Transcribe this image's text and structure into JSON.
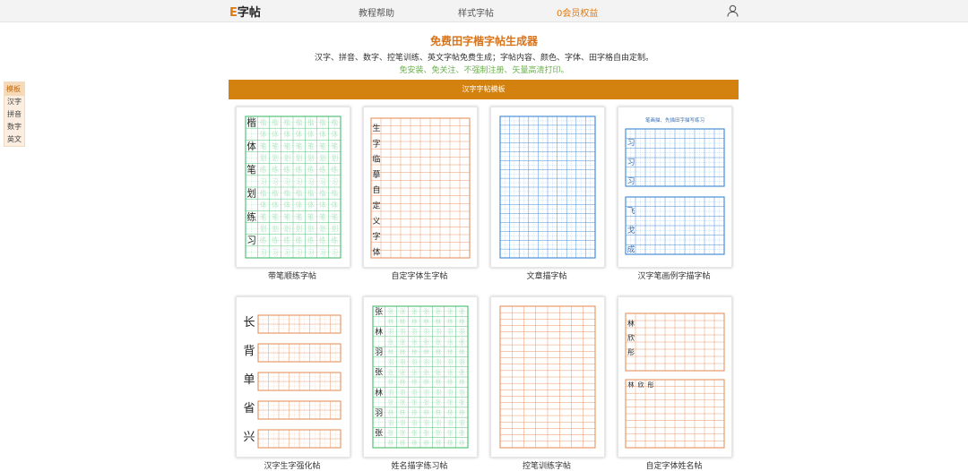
{
  "nav": {
    "logo_e": "E",
    "logo_rest": "字帖",
    "items": [
      "教程帮助",
      "样式字帖",
      "会员权益"
    ],
    "vip_mark": "0"
  },
  "hero": {
    "title": "免费田字楷字帖生成器",
    "subtitle": "汉字、拼音、数字、控笔训练、英文字帖免费生成；字帖内容、颜色、字体、田字格自由定制。",
    "subtitle2": "免安装、免关注、不强制注册、矢量高清打印。"
  },
  "sidemenu": {
    "header": "模板",
    "items": [
      "汉字",
      "拼音",
      "数字",
      "英文"
    ]
  },
  "banner": "汉字字帖模板",
  "templates": [
    {
      "caption": "带笔顺练字帖",
      "color": "#55c27a",
      "chars": [
        "楷",
        "体",
        "笔",
        "划",
        "练",
        "习"
      ]
    },
    {
      "caption": "自定字体生字帖",
      "color": "#e89a6a",
      "chars": [
        "生",
        "字",
        "临",
        "摹",
        "自",
        "定",
        "义",
        "字",
        "体"
      ]
    },
    {
      "caption": "文章描字帖",
      "color": "#4a90d9",
      "chars": []
    },
    {
      "caption": "汉字笔画例字描字帖",
      "color": "#4a90d9",
      "title": "笔画描、先描田字描写练习",
      "chars": [
        "习",
        "习",
        "习",
        "飞",
        "戈",
        "成"
      ]
    },
    {
      "caption": "汉字生字强化帖",
      "color": "#e89a6a",
      "chars": [
        "长",
        "背",
        "单",
        "省",
        "兴"
      ]
    },
    {
      "caption": "姓名描字练习帖",
      "color": "#55c27a",
      "chars": [
        "张",
        "林",
        "羽",
        "张",
        "林",
        "羽"
      ]
    },
    {
      "caption": "控笔训练字帖",
      "color": "#e89a6a",
      "chars": []
    },
    {
      "caption": "自定字体姓名帖",
      "color": "#e89a6a",
      "chars": [
        "林",
        "欣",
        "彤",
        "林",
        "欣",
        "彤"
      ]
    }
  ]
}
